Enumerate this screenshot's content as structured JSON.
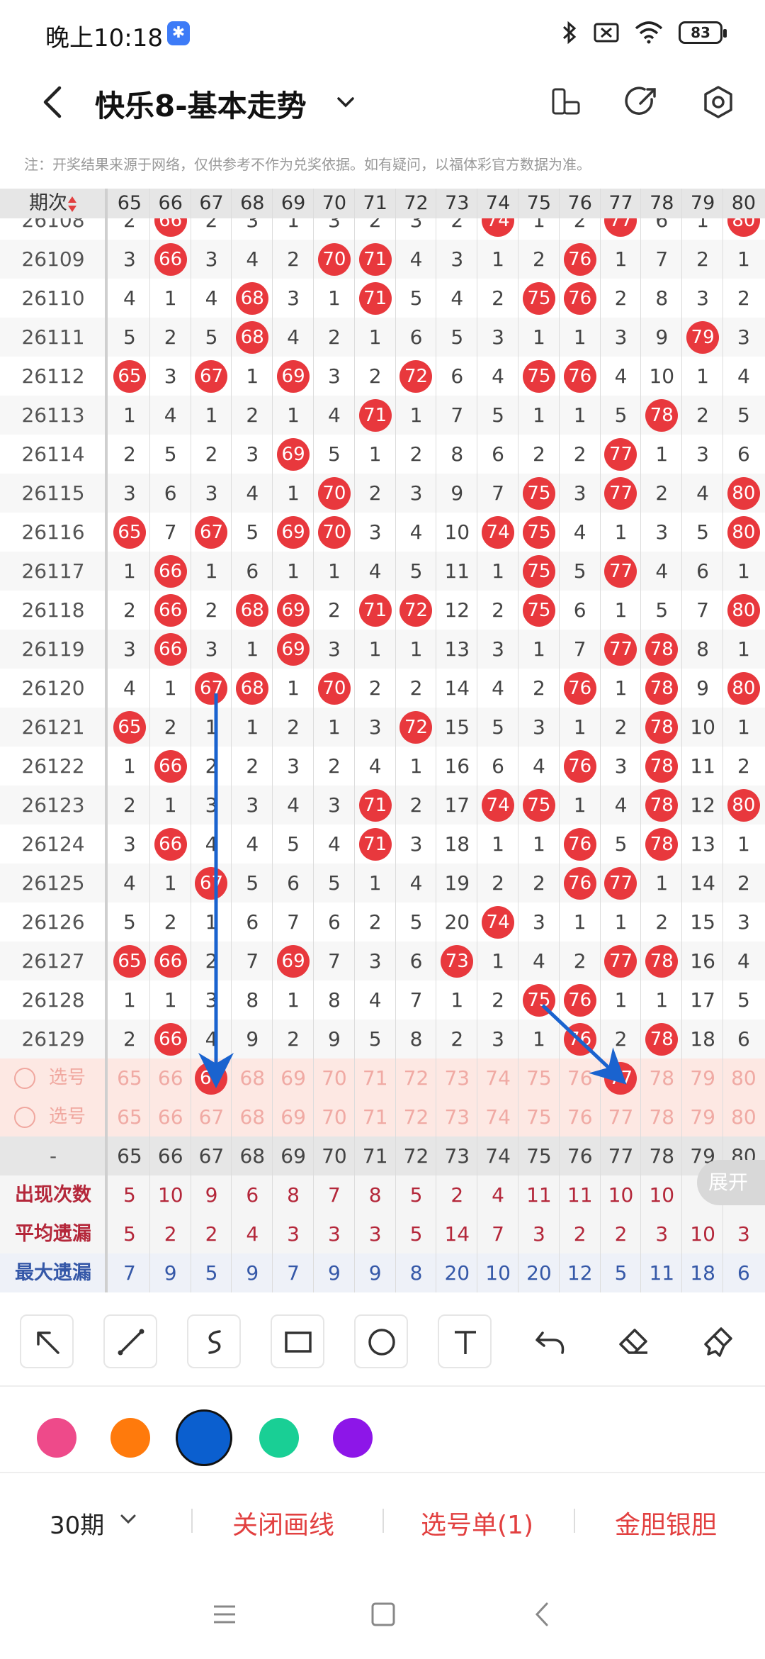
{
  "status": {
    "time": "晚上10:18",
    "battery": "83"
  },
  "header": {
    "title": "快乐8-基本走势"
  },
  "notice": "注：开奖结果来源于网络，仅供参考不作为兑奖依据。如有疑问，以福体彩官方数据为准。",
  "table": {
    "period_header": "期次",
    "columns": [
      "65",
      "66",
      "67",
      "68",
      "69",
      "70",
      "71",
      "72",
      "73",
      "74",
      "75",
      "76",
      "77",
      "78",
      "79",
      "80"
    ],
    "rows": [
      {
        "p": "26108",
        "v": [
          "2",
          "66",
          "2",
          "3",
          "1",
          "3",
          "2",
          "3",
          "2",
          "74",
          "1",
          "2",
          "77",
          "6",
          "1",
          "80"
        ],
        "hit": [
          false,
          true,
          false,
          false,
          false,
          false,
          false,
          false,
          false,
          true,
          false,
          false,
          true,
          false,
          false,
          true
        ]
      },
      {
        "p": "26109",
        "v": [
          "3",
          "66",
          "3",
          "4",
          "2",
          "70",
          "71",
          "4",
          "3",
          "1",
          "2",
          "76",
          "1",
          "7",
          "2",
          "1"
        ],
        "hit": [
          false,
          true,
          false,
          false,
          false,
          true,
          true,
          false,
          false,
          false,
          false,
          true,
          false,
          false,
          false,
          false
        ]
      },
      {
        "p": "26110",
        "v": [
          "4",
          "1",
          "4",
          "68",
          "3",
          "1",
          "71",
          "5",
          "4",
          "2",
          "75",
          "76",
          "2",
          "8",
          "3",
          "2"
        ],
        "hit": [
          false,
          false,
          false,
          true,
          false,
          false,
          true,
          false,
          false,
          false,
          true,
          true,
          false,
          false,
          false,
          false
        ]
      },
      {
        "p": "26111",
        "v": [
          "5",
          "2",
          "5",
          "68",
          "4",
          "2",
          "1",
          "6",
          "5",
          "3",
          "1",
          "1",
          "3",
          "9",
          "79",
          "3"
        ],
        "hit": [
          false,
          false,
          false,
          true,
          false,
          false,
          false,
          false,
          false,
          false,
          false,
          false,
          false,
          false,
          true,
          false
        ]
      },
      {
        "p": "26112",
        "v": [
          "65",
          "3",
          "67",
          "1",
          "69",
          "3",
          "2",
          "72",
          "6",
          "4",
          "75",
          "76",
          "4",
          "10",
          "1",
          "4"
        ],
        "hit": [
          true,
          false,
          true,
          false,
          true,
          false,
          false,
          true,
          false,
          false,
          true,
          true,
          false,
          false,
          false,
          false
        ]
      },
      {
        "p": "26113",
        "v": [
          "1",
          "4",
          "1",
          "2",
          "1",
          "4",
          "71",
          "1",
          "7",
          "5",
          "1",
          "1",
          "5",
          "78",
          "2",
          "5"
        ],
        "hit": [
          false,
          false,
          false,
          false,
          false,
          false,
          true,
          false,
          false,
          false,
          false,
          false,
          false,
          true,
          false,
          false
        ]
      },
      {
        "p": "26114",
        "v": [
          "2",
          "5",
          "2",
          "3",
          "69",
          "5",
          "1",
          "2",
          "8",
          "6",
          "2",
          "2",
          "77",
          "1",
          "3",
          "6"
        ],
        "hit": [
          false,
          false,
          false,
          false,
          true,
          false,
          false,
          false,
          false,
          false,
          false,
          false,
          true,
          false,
          false,
          false
        ]
      },
      {
        "p": "26115",
        "v": [
          "3",
          "6",
          "3",
          "4",
          "1",
          "70",
          "2",
          "3",
          "9",
          "7",
          "75",
          "3",
          "77",
          "2",
          "4",
          "80"
        ],
        "hit": [
          false,
          false,
          false,
          false,
          false,
          true,
          false,
          false,
          false,
          false,
          true,
          false,
          true,
          false,
          false,
          true
        ]
      },
      {
        "p": "26116",
        "v": [
          "65",
          "7",
          "67",
          "5",
          "69",
          "70",
          "3",
          "4",
          "10",
          "74",
          "75",
          "4",
          "1",
          "3",
          "5",
          "80"
        ],
        "hit": [
          true,
          false,
          true,
          false,
          true,
          true,
          false,
          false,
          false,
          true,
          true,
          false,
          false,
          false,
          false,
          true
        ]
      },
      {
        "p": "26117",
        "v": [
          "1",
          "66",
          "1",
          "6",
          "1",
          "1",
          "4",
          "5",
          "11",
          "1",
          "75",
          "5",
          "77",
          "4",
          "6",
          "1"
        ],
        "hit": [
          false,
          true,
          false,
          false,
          false,
          false,
          false,
          false,
          false,
          false,
          true,
          false,
          true,
          false,
          false,
          false
        ]
      },
      {
        "p": "26118",
        "v": [
          "2",
          "66",
          "2",
          "68",
          "69",
          "2",
          "71",
          "72",
          "12",
          "2",
          "75",
          "6",
          "1",
          "5",
          "7",
          "80"
        ],
        "hit": [
          false,
          true,
          false,
          true,
          true,
          false,
          true,
          true,
          false,
          false,
          true,
          false,
          false,
          false,
          false,
          true
        ]
      },
      {
        "p": "26119",
        "v": [
          "3",
          "66",
          "3",
          "1",
          "69",
          "3",
          "1",
          "1",
          "13",
          "3",
          "1",
          "7",
          "77",
          "78",
          "8",
          "1"
        ],
        "hit": [
          false,
          true,
          false,
          false,
          true,
          false,
          false,
          false,
          false,
          false,
          false,
          false,
          true,
          true,
          false,
          false
        ]
      },
      {
        "p": "26120",
        "v": [
          "4",
          "1",
          "67",
          "68",
          "1",
          "70",
          "2",
          "2",
          "14",
          "4",
          "2",
          "76",
          "1",
          "78",
          "9",
          "80"
        ],
        "hit": [
          false,
          false,
          true,
          true,
          false,
          true,
          false,
          false,
          false,
          false,
          false,
          true,
          false,
          true,
          false,
          true
        ]
      },
      {
        "p": "26121",
        "v": [
          "65",
          "2",
          "1",
          "1",
          "2",
          "1",
          "3",
          "72",
          "15",
          "5",
          "3",
          "1",
          "2",
          "78",
          "10",
          "1"
        ],
        "hit": [
          true,
          false,
          false,
          false,
          false,
          false,
          false,
          true,
          false,
          false,
          false,
          false,
          false,
          true,
          false,
          false
        ]
      },
      {
        "p": "26122",
        "v": [
          "1",
          "66",
          "2",
          "2",
          "3",
          "2",
          "4",
          "1",
          "16",
          "6",
          "4",
          "76",
          "3",
          "78",
          "11",
          "2"
        ],
        "hit": [
          false,
          true,
          false,
          false,
          false,
          false,
          false,
          false,
          false,
          false,
          false,
          true,
          false,
          true,
          false,
          false
        ]
      },
      {
        "p": "26123",
        "v": [
          "2",
          "1",
          "3",
          "3",
          "4",
          "3",
          "71",
          "2",
          "17",
          "74",
          "75",
          "1",
          "4",
          "78",
          "12",
          "80"
        ],
        "hit": [
          false,
          false,
          false,
          false,
          false,
          false,
          true,
          false,
          false,
          true,
          true,
          false,
          false,
          true,
          false,
          true
        ]
      },
      {
        "p": "26124",
        "v": [
          "3",
          "66",
          "4",
          "4",
          "5",
          "4",
          "71",
          "3",
          "18",
          "1",
          "1",
          "76",
          "5",
          "78",
          "13",
          "1"
        ],
        "hit": [
          false,
          true,
          false,
          false,
          false,
          false,
          true,
          false,
          false,
          false,
          false,
          true,
          false,
          true,
          false,
          false
        ]
      },
      {
        "p": "26125",
        "v": [
          "4",
          "1",
          "67",
          "5",
          "6",
          "5",
          "1",
          "4",
          "19",
          "2",
          "2",
          "76",
          "77",
          "1",
          "14",
          "2"
        ],
        "hit": [
          false,
          false,
          true,
          false,
          false,
          false,
          false,
          false,
          false,
          false,
          false,
          true,
          true,
          false,
          false,
          false
        ]
      },
      {
        "p": "26126",
        "v": [
          "5",
          "2",
          "1",
          "6",
          "7",
          "6",
          "2",
          "5",
          "20",
          "74",
          "3",
          "1",
          "1",
          "2",
          "15",
          "3"
        ],
        "hit": [
          false,
          false,
          false,
          false,
          false,
          false,
          false,
          false,
          false,
          true,
          false,
          false,
          false,
          false,
          false,
          false
        ]
      },
      {
        "p": "26127",
        "v": [
          "65",
          "66",
          "2",
          "7",
          "69",
          "7",
          "3",
          "6",
          "73",
          "1",
          "4",
          "2",
          "77",
          "78",
          "16",
          "4"
        ],
        "hit": [
          true,
          true,
          false,
          false,
          true,
          false,
          false,
          false,
          true,
          false,
          false,
          false,
          true,
          true,
          false,
          false
        ]
      },
      {
        "p": "26128",
        "v": [
          "1",
          "1",
          "3",
          "8",
          "1",
          "8",
          "4",
          "7",
          "1",
          "2",
          "75",
          "76",
          "1",
          "1",
          "17",
          "5"
        ],
        "hit": [
          false,
          false,
          false,
          false,
          false,
          false,
          false,
          false,
          false,
          false,
          true,
          true,
          false,
          false,
          false,
          false
        ]
      },
      {
        "p": "26129",
        "v": [
          "2",
          "66",
          "4",
          "9",
          "2",
          "9",
          "5",
          "8",
          "2",
          "3",
          "1",
          "76",
          "2",
          "78",
          "18",
          "6"
        ],
        "hit": [
          false,
          true,
          false,
          false,
          false,
          false,
          false,
          false,
          false,
          false,
          false,
          true,
          false,
          true,
          false,
          false
        ]
      }
    ],
    "select_label": "选号",
    "select_rows": [
      {
        "hit": [
          false,
          false,
          true,
          false,
          false,
          false,
          false,
          false,
          false,
          false,
          false,
          false,
          true,
          false,
          false,
          false
        ]
      },
      {
        "hit": [
          false,
          false,
          false,
          false,
          false,
          false,
          false,
          false,
          false,
          false,
          false,
          false,
          false,
          false,
          false,
          false
        ]
      }
    ],
    "footer_dash": "-",
    "stats": [
      {
        "label": "出现次数",
        "values": [
          "5",
          "10",
          "9",
          "6",
          "8",
          "7",
          "8",
          "5",
          "2",
          "4",
          "11",
          "11",
          "10",
          "10",
          "",
          ""
        ]
      },
      {
        "label": "平均遗漏",
        "values": [
          "5",
          "2",
          "2",
          "4",
          "3",
          "3",
          "3",
          "5",
          "14",
          "7",
          "3",
          "2",
          "2",
          "3",
          "10",
          "3"
        ]
      },
      {
        "label": "最大遗漏",
        "values": [
          "7",
          "9",
          "5",
          "9",
          "7",
          "9",
          "9",
          "8",
          "20",
          "10",
          "20",
          "12",
          "5",
          "11",
          "18",
          "6"
        ]
      }
    ],
    "expand_label": "展开"
  },
  "tools": [
    "arrow-tool",
    "line-tool",
    "curve-tool",
    "rect-tool",
    "circle-tool",
    "text-tool",
    "undo-tool",
    "eraser-tool",
    "clear-tool"
  ],
  "colors": [
    "#ee4a8a",
    "#ff7a0c",
    "#0b5fcf",
    "#19cf95",
    "#8d16e8"
  ],
  "bottom": {
    "period": "30期",
    "close_draw": "关闭画线",
    "select_list": "选号单(1)",
    "gold": "金胆银胆"
  }
}
